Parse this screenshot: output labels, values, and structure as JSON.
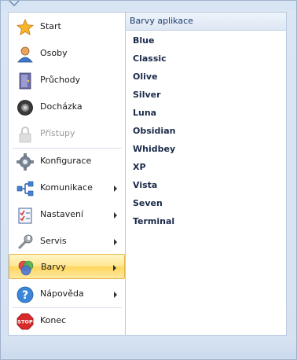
{
  "menu": {
    "items": [
      {
        "label": "Start",
        "icon": "star-icon",
        "submenu": false,
        "disabled": false,
        "selected": false
      },
      {
        "label": "Osoby",
        "icon": "person-icon",
        "submenu": false,
        "disabled": false,
        "selected": false
      },
      {
        "label": "Průchody",
        "icon": "door-icon",
        "submenu": false,
        "disabled": false,
        "selected": false
      },
      {
        "label": "Docházka",
        "icon": "camera-icon",
        "submenu": false,
        "disabled": false,
        "selected": false
      },
      {
        "label": "Přístupy",
        "icon": "lock-icon",
        "submenu": false,
        "disabled": true,
        "selected": false
      },
      {
        "label": "Konfigurace",
        "icon": "gear-icon",
        "submenu": false,
        "disabled": false,
        "selected": false
      },
      {
        "label": "Komunikace",
        "icon": "network-icon",
        "submenu": true,
        "disabled": false,
        "selected": false
      },
      {
        "label": "Nastavení",
        "icon": "checklist-icon",
        "submenu": true,
        "disabled": false,
        "selected": false
      },
      {
        "label": "Servis",
        "icon": "wrench-icon",
        "submenu": true,
        "disabled": false,
        "selected": false
      },
      {
        "label": "Barvy",
        "icon": "colors-icon",
        "submenu": true,
        "disabled": false,
        "selected": true
      },
      {
        "label": "Nápověda",
        "icon": "help-icon",
        "submenu": true,
        "disabled": false,
        "selected": false
      },
      {
        "label": "Konec",
        "icon": "stop-icon",
        "submenu": false,
        "disabled": false,
        "selected": false
      }
    ]
  },
  "submenu": {
    "header": "Barvy aplikace",
    "items": [
      "Blue",
      "Classic",
      "Olive",
      "Silver",
      "Luna",
      "Obsidian",
      "Whidbey",
      "XP",
      "Vista",
      "Seven",
      "Terminal"
    ]
  },
  "colors": {
    "accent": "#ffd65c",
    "frame": "#d6e2f1",
    "submenu_text": "#1a2a4a"
  }
}
